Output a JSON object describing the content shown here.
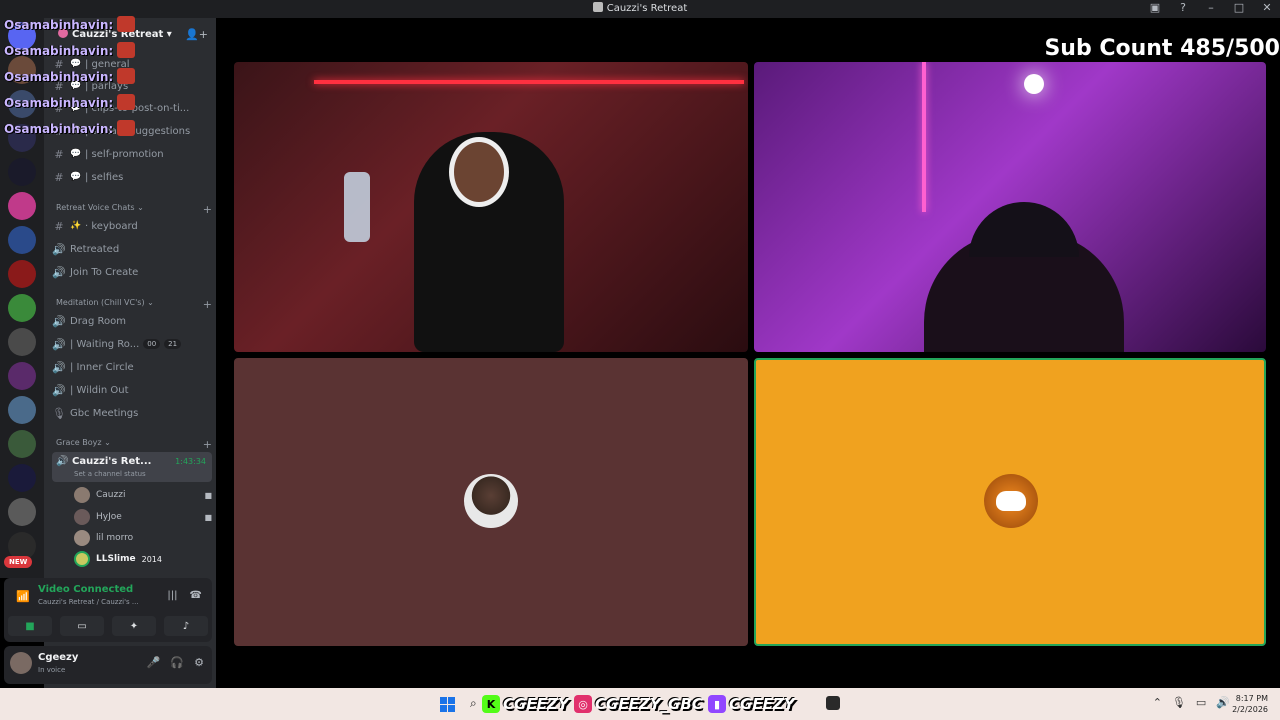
{
  "window": {
    "title": "Cauzzi's Retreat"
  },
  "overlay": {
    "sub_count": "Sub Count 485/500"
  },
  "chat": {
    "lines": [
      "Osamabinhavin:",
      "Osamabinhavin:",
      "Osamabinhavin:",
      "Osamabinhavin:",
      "Osamabinhavin:"
    ]
  },
  "server": {
    "name": "Cauzzi's Retreat",
    "channels": [
      {
        "name": "| general",
        "emoji": "💬"
      },
      {
        "name": "| parlays",
        "emoji": "💬"
      },
      {
        "name": "| clips-to-post-on-ti...",
        "emoji": "💬"
      },
      {
        "name": "| stream-suggestions",
        "emoji": "💬"
      },
      {
        "name": "| self-promotion",
        "emoji": "💬"
      },
      {
        "name": "| selfies",
        "emoji": "💬"
      }
    ],
    "categories": {
      "retreat_vc": "Retreat Voice Chats",
      "meditation": "Meditation (Chill VC's)",
      "grace": "Grace Boyz"
    },
    "retreat_vcs": [
      {
        "name": "· keyboard",
        "prefix": "#"
      },
      {
        "name": "Retreated",
        "prefix": "🔊"
      },
      {
        "name": "Join To Create",
        "prefix": "🔊"
      }
    ],
    "meditation_vcs": [
      {
        "name": "Drag Room",
        "prefix": "🔊"
      },
      {
        "name": "| Waiting Ro...",
        "prefix": "🔊",
        "pill_a": "00",
        "pill_b": "21"
      },
      {
        "name": "| Inner Circle",
        "prefix": "🔊"
      },
      {
        "name": "| Wildin Out",
        "prefix": "🔊"
      },
      {
        "name": "Gbc Meetings",
        "prefix": "🎙"
      }
    ],
    "active_vc": {
      "name": "Cauzzi's Ret...",
      "timer": "1:43:34",
      "status": "Set a channel status"
    },
    "members": [
      {
        "name": "Cauzzi"
      },
      {
        "name": "HyJoe"
      },
      {
        "name": "lil morro"
      },
      {
        "name": "LLSlime",
        "tag": "2014"
      }
    ]
  },
  "guilds": {
    "new_badge": "NEW"
  },
  "voice_panel": {
    "title": "Video Connected",
    "subtitle": "Cauzzi's Retreat / Cauzzi's ..."
  },
  "user": {
    "name": "Cgeezy",
    "status": "In voice"
  },
  "taskbar": {
    "socials": [
      {
        "handle": "CGEEZY",
        "platform": "kick-icon",
        "color": "#53fc18"
      },
      {
        "handle": "CGEEZY_GBC",
        "platform": "instagram-icon",
        "color": "#e1306c"
      },
      {
        "handle": "CGEEZY",
        "platform": "twitch-icon",
        "color": "#9146ff"
      }
    ],
    "time": "8:17 PM",
    "date": "2/2/2026"
  }
}
